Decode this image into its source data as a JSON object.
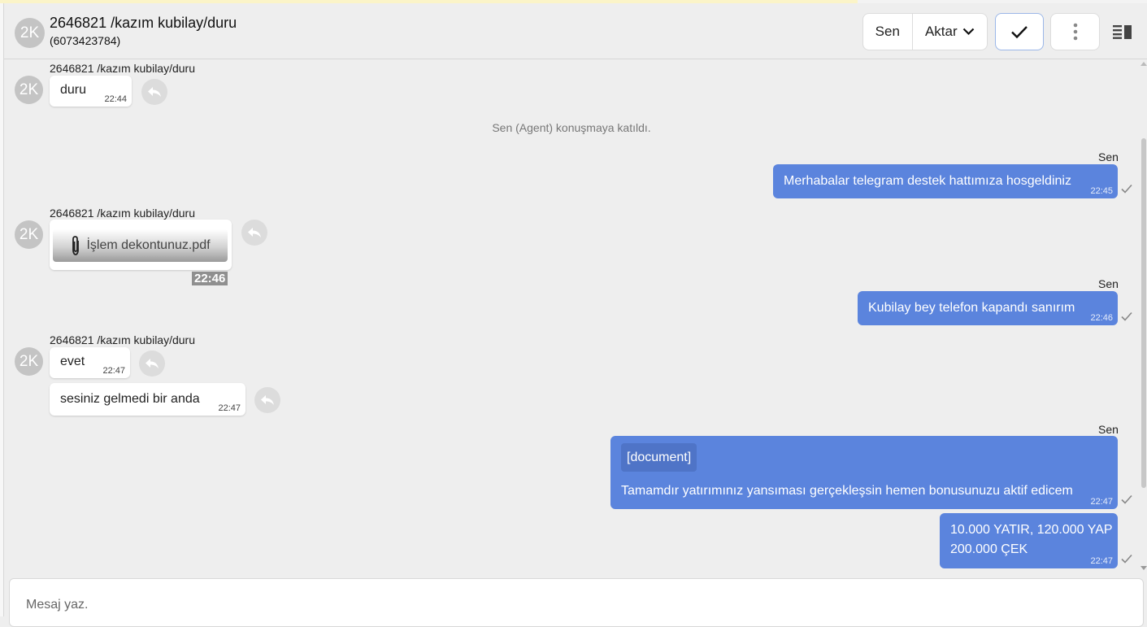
{
  "header": {
    "avatar_initials": "2K",
    "title": "2646821 /kazım kubilay/duru",
    "subtitle": "(6073423784)",
    "sen_label": "Sen",
    "aktar_label": "Aktar",
    "icons": [
      "chevron-down-icon",
      "check-icon",
      "more-vertical-icon",
      "side-panel-icon"
    ]
  },
  "colors": {
    "outgoing_bubble": "#5b84dd",
    "incoming_bubble": "#ffffff",
    "background": "#eeeeee",
    "avatar": "#c4c4c4"
  },
  "messages": {
    "m1": {
      "sender": "2646821 /kazım kubilay/duru",
      "avatar": "2K",
      "text": "duru",
      "time": "22:44"
    },
    "system": {
      "text": "Sen (Agent) konuşmaya katıldı."
    },
    "m2": {
      "sender": "Sen",
      "text": "Merhabalar telegram destek hattımıza hosgeldiniz",
      "time": "22:45"
    },
    "m3": {
      "sender": "2646821 /kazım kubilay/duru",
      "avatar": "2K",
      "file": "İşlem dekontunuz.pdf",
      "time": "22:46"
    },
    "m4": {
      "sender": "Sen",
      "text": "Kubilay bey telefon kapandı sanırım",
      "time": "22:46"
    },
    "m5": {
      "sender": "2646821 /kazım kubilay/duru",
      "avatar": "2K",
      "text": "evet",
      "time": "22:47"
    },
    "m6": {
      "text": "sesiniz gelmedi bir anda",
      "time": "22:47"
    },
    "m7": {
      "sender": "Sen",
      "tag": "[document]",
      "text": "Tamamdır yatırımınız yansıması gerçekleşsin hemen bonusunuzu aktif edicem",
      "time": "22:47"
    },
    "m8": {
      "line1": "10.000 YATIR, 120.000 YAP",
      "line2": "200.000 ÇEK",
      "time": "22:47"
    }
  },
  "composer": {
    "placeholder": "Mesaj yaz."
  }
}
